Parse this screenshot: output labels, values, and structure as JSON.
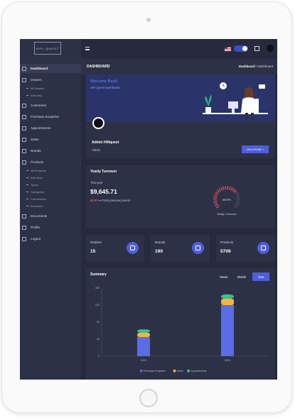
{
  "brand": {
    "logo_text": "HIFI QUEST"
  },
  "sidebar": {
    "items": [
      {
        "label": "Dashboard",
        "icon": "dashboard-icon",
        "active": true
      },
      {
        "label": "Dealers",
        "icon": "dealers-icon"
      },
      {
        "label": "All Dealers",
        "sub": true
      },
      {
        "label": "Add New",
        "sub": true
      },
      {
        "label": "Customers",
        "icon": "customers-icon"
      },
      {
        "label": "Purchase Enquiries",
        "icon": "enquiries-icon"
      },
      {
        "label": "Appointments",
        "icon": "calendar-icon"
      },
      {
        "label": "Sales",
        "icon": "sales-icon"
      },
      {
        "label": "Brands",
        "icon": "brands-icon"
      },
      {
        "label": "Products",
        "icon": "products-icon"
      },
      {
        "label": "All Products",
        "sub": true
      },
      {
        "label": "Add New",
        "sub": true
      },
      {
        "label": "Types",
        "sub": true
      },
      {
        "label": "Categories",
        "sub": true
      },
      {
        "label": "Connections",
        "sub": true
      },
      {
        "label": "Execution",
        "sub": true
      },
      {
        "label": "Documents",
        "icon": "documents-icon"
      },
      {
        "label": "Profile",
        "icon": "profile-icon"
      },
      {
        "label": "Logout",
        "icon": "logout-icon"
      }
    ]
  },
  "topbar": {
    "theme_toggle_on": true
  },
  "header": {
    "title": "DASHBOARD",
    "breadcrumb_root": "Dashboard",
    "breadcrumb_sep": "/",
    "breadcrumb_current": "Dashboard"
  },
  "welcome": {
    "title": "Welcome Back!",
    "subtitle": "HiFi Quest Dashboard",
    "name": "Admin Hifiquest",
    "role": "Admin",
    "button": "View Profile"
  },
  "turnover": {
    "title": "Yearly Turnover",
    "period_label": "This year",
    "value": "$9,645.71",
    "change": "68.9%",
    "change_note": "From previous period",
    "gauge_label": "Yearly Turnover",
    "gauge_value": "68.9%",
    "gauge_fraction": 0.689
  },
  "stats": [
    {
      "label": "Dealers",
      "value": "15",
      "icon": "dealers-stat-icon"
    },
    {
      "label": "Brands",
      "value": "190",
      "icon": "brands-stat-icon"
    },
    {
      "label": "Products",
      "value": "5706",
      "icon": "products-stat-icon"
    }
  ],
  "summary": {
    "title": "Summary",
    "tabs": [
      "Week",
      "Month",
      "Year"
    ],
    "active_tab": "Year"
  },
  "colors": {
    "accent": "#4e5fd9",
    "purchase": "#5b6de6",
    "sales": "#f3b43f",
    "appointment": "#34c38f"
  },
  "chart_data": {
    "type": "bar",
    "stacked": true,
    "categories": [
      "2022",
      "2023"
    ],
    "yticks": [
      "0",
      "40",
      "80",
      "120",
      "160"
    ],
    "ylim": [
      0,
      160
    ],
    "series": [
      {
        "name": "Purchase Enquiries",
        "color": "#5b6de6",
        "values": [
          45,
          120
        ]
      },
      {
        "name": "Sales",
        "color": "#f3b43f",
        "values": [
          10,
          15
        ]
      },
      {
        "name": "Appointments",
        "color": "#34c38f",
        "values": [
          8,
          10
        ]
      }
    ],
    "legend": "bottom",
    "grid": false
  }
}
